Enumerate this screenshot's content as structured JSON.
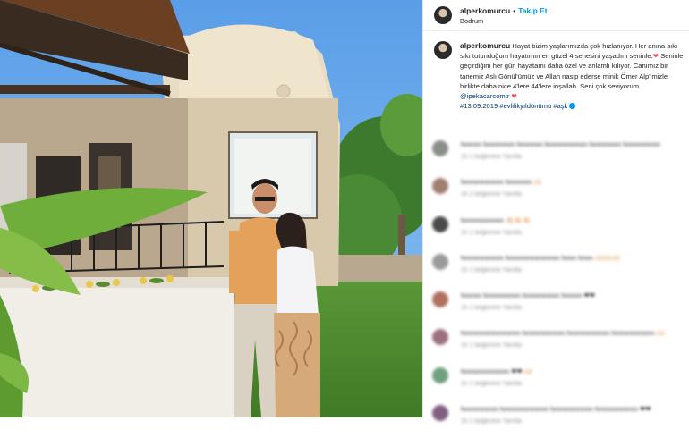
{
  "post": {
    "username": "alperkomurcu",
    "separator": "•",
    "follow_label": "Takip Et",
    "location": "Bodrum"
  },
  "caption": {
    "text_1": "Hayat bizim yaşlarımızda çok hızlanıyor. Her anına sıkı sıkı tutunduğum hayatımın en güzel 4 senesini yaşadım seninle.",
    "heart": "❤",
    "text_2": " Seninle geçirdiğim her gün hayatamı daha özel ve anlamlı kılıyor. Canımız bir tanemiz Aslı Gönül'ümüz ve Allah nasip ederse minik Ömer Alp'imizle birlikte daha nice 4'lere 44'lere inşallah. Seni çok seviyorum ",
    "mention": "@ipekacarcomtr",
    "text_3": " ",
    "date_tag": "#13.09.2019",
    "tag_1": "#evlilikyıldönümü",
    "tag_2": "#aşk"
  },
  "comments": [
    {
      "text": "hmmm hmmmmm hmmmm hmmmmmmm hmmmmm hmmmmmm",
      "meta": "1h  1 beğenme  Yanıtla",
      "color": "#8a8f8a"
    },
    {
      "text": "hmmmmmmm hmmmm 🙌🏻",
      "meta": "1h  2 beğenme  Yanıtla",
      "color": "#a08070"
    },
    {
      "text": "hmmmmmmm 👏🏻👏🏻👏🏻",
      "meta": "1h  1 beğenme  Yanıtla",
      "color": "#4a4a4a"
    },
    {
      "text": "hmmmmmmm hmmmmmmmmm hmm hmm 🙌🏻🙌🏻🙌🏻",
      "meta": "1h  1 beğenme  Yanıtla",
      "color": "#9a9a9a"
    },
    {
      "text": "hmmm hmmmmmm hmmmmmm hmmm ❤❤",
      "meta": "1h  1 beğenme  Yanıtla",
      "color": "#b07060"
    },
    {
      "text": "hmmmmmmmmmm hmmmmmmm hmmmmmmm hmmmmmmm 🙌🏻",
      "meta": "1h  1 beğenme  Yanıtla",
      "color": "#9c7080"
    },
    {
      "text": "hmmmmmmmm ❤❤ 🙌🏻",
      "meta": "1h  1 beğenme  Yanıtla",
      "color": "#70a080"
    },
    {
      "text": "hmmmmmm hmmmmmmmm hmmmmmmm hmmmmmmm ❤❤",
      "meta": "1h  1 beğenme  Yanıtla",
      "color": "#806080"
    }
  ]
}
